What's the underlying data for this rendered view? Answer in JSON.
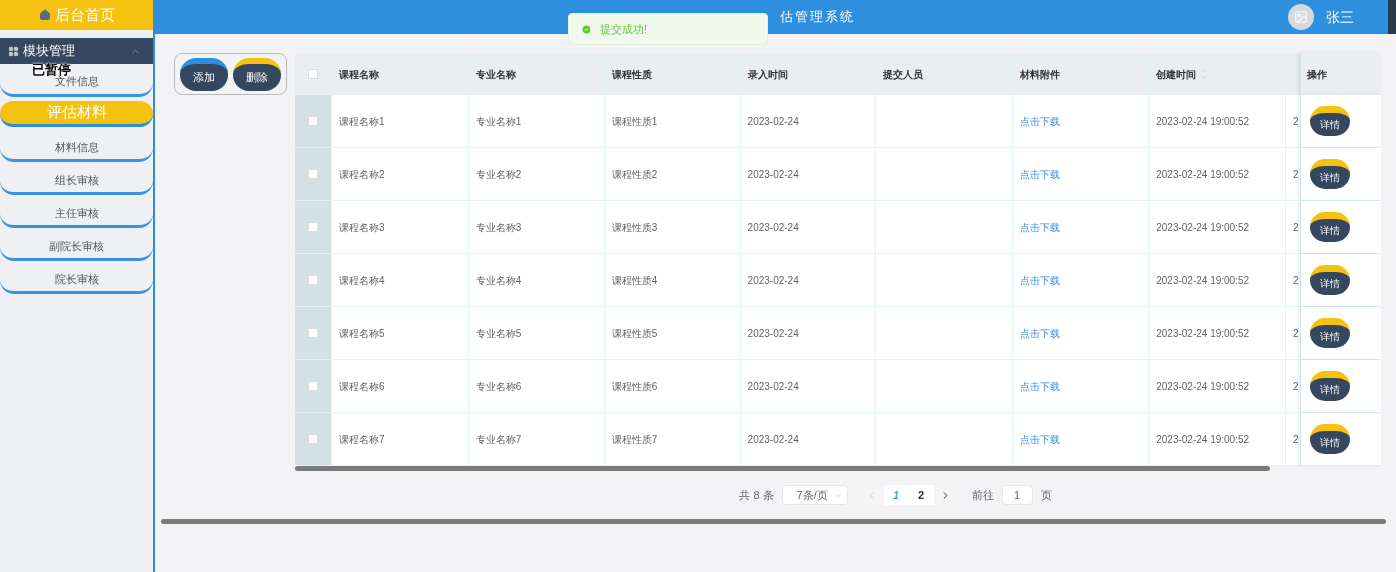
{
  "sidebar": {
    "home": "后台首页",
    "group": {
      "label": "模块管理",
      "expanded": true
    },
    "items": [
      {
        "label": "文件信息",
        "kind": "item"
      },
      {
        "label": "评估材料",
        "kind": "section"
      },
      {
        "label": "材料信息",
        "kind": "item"
      },
      {
        "label": "组长审核",
        "kind": "item"
      },
      {
        "label": "主任审核",
        "kind": "item"
      },
      {
        "label": "副院长审核",
        "kind": "item"
      },
      {
        "label": "院长审核",
        "kind": "item"
      }
    ]
  },
  "overlay_label": "已暂停",
  "header": {
    "title": "估管理系统",
    "user": "张三"
  },
  "toast": {
    "message": "提交成功!"
  },
  "toolbar": {
    "buttons": [
      {
        "label": "添加",
        "color": "#2d8fdd"
      },
      {
        "label": "删除",
        "color": "#f5c211"
      }
    ]
  },
  "table": {
    "columns": [
      {
        "label": "课程名称"
      },
      {
        "label": "专业名称"
      },
      {
        "label": "课程性质"
      },
      {
        "label": "录入时间"
      },
      {
        "label": "提交人员"
      },
      {
        "label": "材料附件"
      },
      {
        "label": "创建时间",
        "sortable": true
      },
      {}
    ],
    "all_selected": false,
    "action_header": "操作",
    "rows": [
      {
        "selected": false,
        "cells": [
          "课程名称1",
          "专业名称1",
          "课程性质1",
          "2023-02-24",
          "",
          "点击下载",
          "2023-02-24 19:00:52",
          "2"
        ],
        "action": "详情"
      },
      {
        "selected": false,
        "cells": [
          "课程名称2",
          "专业名称2",
          "课程性质2",
          "2023-02-24",
          "",
          "点击下载",
          "2023-02-24 19:00:52",
          "2"
        ],
        "action": "详情"
      },
      {
        "selected": false,
        "cells": [
          "课程名称3",
          "专业名称3",
          "课程性质3",
          "2023-02-24",
          "",
          "点击下载",
          "2023-02-24 19:00:52",
          "2"
        ],
        "action": "详情"
      },
      {
        "selected": false,
        "cells": [
          "课程名称4",
          "专业名称4",
          "课程性质4",
          "2023-02-24",
          "",
          "点击下载",
          "2023-02-24 19:00:52",
          "2"
        ],
        "action": "详情"
      },
      {
        "selected": false,
        "cells": [
          "课程名称5",
          "专业名称5",
          "课程性质5",
          "2023-02-24",
          "",
          "点击下载",
          "2023-02-24 19:00:52",
          "2"
        ],
        "action": "详情"
      },
      {
        "selected": false,
        "cells": [
          "课程名称6",
          "专业名称6",
          "课程性质6",
          "2023-02-24",
          "",
          "点击下载",
          "2023-02-24 19:00:52",
          "2"
        ],
        "action": "详情"
      },
      {
        "selected": false,
        "cells": [
          "课程名称7",
          "专业名称7",
          "课程性质7",
          "2023-02-24",
          "",
          "点击下载",
          "2023-02-24 19:00:52",
          "2"
        ],
        "action": "详情"
      }
    ]
  },
  "pagination": {
    "total": "共 8 条",
    "page_size": "7条/页",
    "pages": [
      {
        "label": "1",
        "selected": true
      },
      {
        "label": "2",
        "selected": false
      }
    ],
    "goto_label": "前往",
    "goto_value": "1",
    "goto_suffix": "页"
  }
}
